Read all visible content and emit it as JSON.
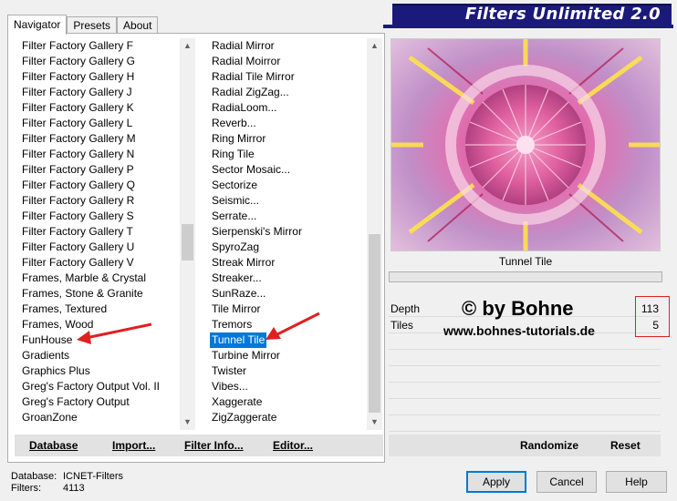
{
  "tabs": [
    "Navigator",
    "Presets",
    "About"
  ],
  "banner_title": "Filters Unlimited 2.0",
  "categories": [
    "Filter Factory Gallery F",
    "Filter Factory Gallery G",
    "Filter Factory Gallery H",
    "Filter Factory Gallery J",
    "Filter Factory Gallery K",
    "Filter Factory Gallery L",
    "Filter Factory Gallery M",
    "Filter Factory Gallery N",
    "Filter Factory Gallery P",
    "Filter Factory Gallery Q",
    "Filter Factory Gallery R",
    "Filter Factory Gallery S",
    "Filter Factory Gallery T",
    "Filter Factory Gallery U",
    "Filter Factory Gallery V",
    "Frames, Marble & Crystal",
    "Frames, Stone & Granite",
    "Frames, Textured",
    "Frames, Wood",
    "FunHouse",
    "Gradients",
    "Graphics Plus",
    "Greg's Factory Output Vol. II",
    "Greg's Factory Output",
    "GroanZone"
  ],
  "filters": [
    "Radial Mirror",
    "Radial Moirror",
    "Radial Tile Mirror",
    "Radial ZigZag...",
    "RadiaLoom...",
    "Reverb...",
    "Ring Mirror",
    "Ring Tile",
    "Sector Mosaic...",
    "Sectorize",
    "Seismic...",
    "Serrate...",
    "Sierpenski's Mirror",
    "SpyroZag",
    "Streak Mirror",
    "Streaker...",
    "SunRaze...",
    "Tile Mirror",
    "Tremors",
    "Tunnel Tile",
    "Turbine Mirror",
    "Twister",
    "Vibes...",
    "Xaggerate",
    "ZigZaggerate"
  ],
  "selected_filter": "Tunnel Tile",
  "preview_label": "Tunnel Tile",
  "params": [
    {
      "label": "Depth",
      "value": "113"
    },
    {
      "label": "Tiles",
      "value": "5"
    }
  ],
  "watermark": {
    "line1": "© by Bohne",
    "line2": "www.bohnes-tutorials.de"
  },
  "toolbar_left": [
    "Database",
    "Import...",
    "Filter Info...",
    "Editor..."
  ],
  "toolbar_right": [
    "Randomize",
    "Reset"
  ],
  "status": {
    "database_label": "Database:",
    "database_value": "ICNET-Filters",
    "filters_label": "Filters:",
    "filters_value": "4113"
  },
  "buttons": {
    "apply": "Apply",
    "cancel": "Cancel",
    "help": "Help"
  },
  "colors": {
    "selection": "#0078d7",
    "banner": "#1a1a7a",
    "annotation": "#e02020"
  }
}
